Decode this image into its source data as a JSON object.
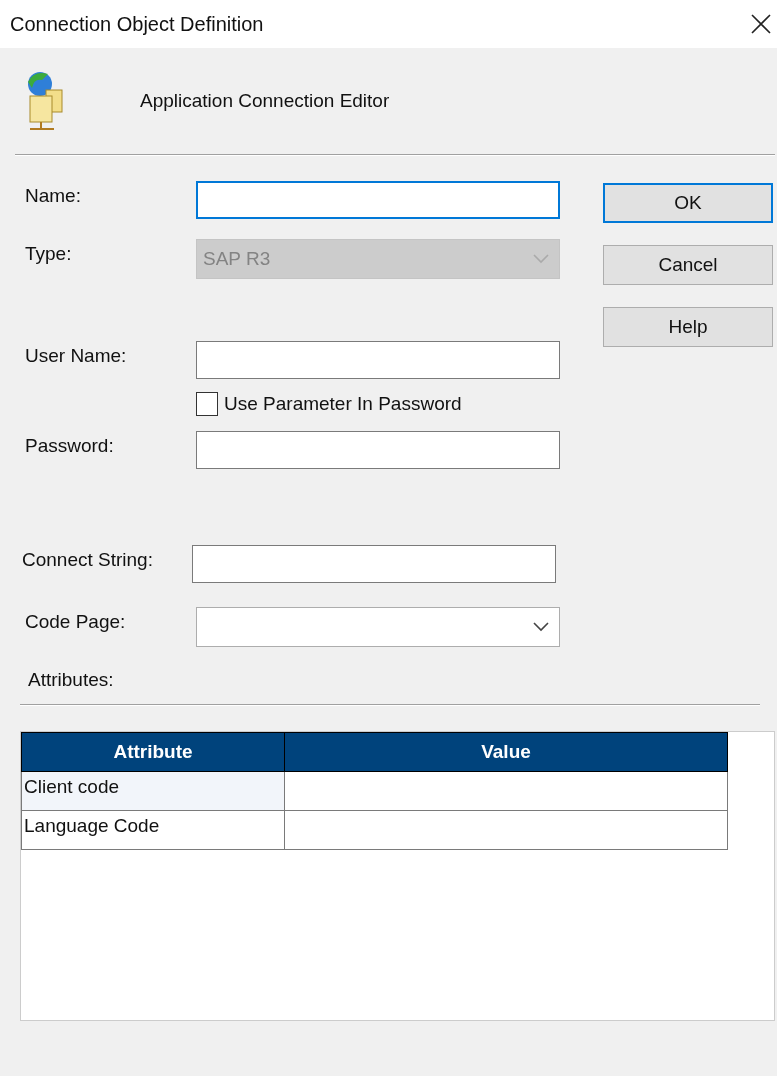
{
  "window": {
    "title": "Connection Object Definition"
  },
  "header": {
    "title": "Application Connection Editor"
  },
  "sections": [
    [
      {
        "kind": "text",
        "label": "Name:",
        "focused": true
      },
      {
        "kind": "select",
        "label": "Type:",
        "value": "SAP R3",
        "disabled": true
      }
    ],
    [
      {
        "kind": "text",
        "label": "User Name:",
        "focused": false
      },
      {
        "kind": "checkbox",
        "label": "Use Parameter In Password",
        "checked": false
      },
      {
        "kind": "text",
        "label": "Password:",
        "focused": false
      }
    ],
    [
      {
        "kind": "text",
        "label": "Connect String:",
        "focused": false
      },
      {
        "kind": "select",
        "label": "Code Page:",
        "disabled": false
      }
    ]
  ],
  "buttons": [
    {
      "label": "OK",
      "default": true
    },
    {
      "label": "Cancel",
      "default": false
    },
    {
      "label": "Help",
      "default": false
    }
  ],
  "attributes_label": "Attributes:",
  "table": {
    "columns": [
      "Attribute",
      "Value"
    ],
    "rows": [
      {
        "cells": [
          "Client code",
          ""
        ],
        "selected": true
      },
      {
        "cells": [
          "Language Code",
          ""
        ],
        "selected": false
      }
    ]
  }
}
